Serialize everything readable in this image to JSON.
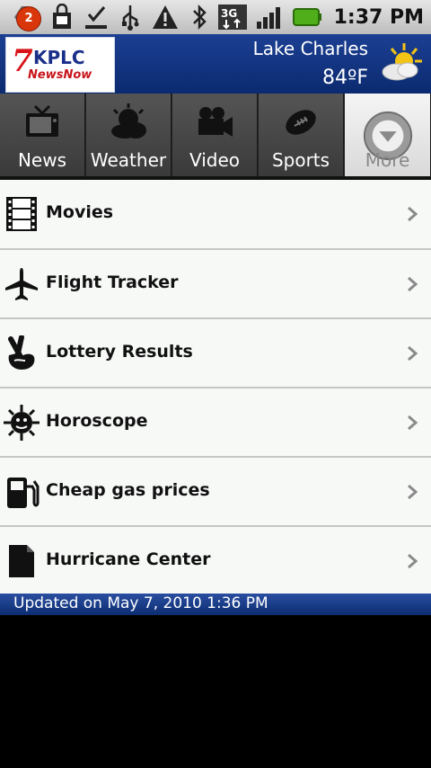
{
  "status_bar": {
    "time": "1:37 PM",
    "notification_count": "2",
    "network": "3G",
    "icons": [
      "notification-badge-icon",
      "shopping-bag-icon",
      "download-done-icon",
      "usb-icon",
      "warning-icon",
      "bluetooth-icon",
      "network-3g-icon",
      "signal-icon",
      "battery-icon"
    ]
  },
  "header": {
    "logo_seven": "7",
    "logo_name": "KPLC",
    "logo_tagline": "NewsNow",
    "city": "Lake Charles",
    "temperature": "84ºF",
    "weather_icon": "partly-cloudy-icon"
  },
  "tabs": [
    {
      "label": "News",
      "icon": "tv-icon"
    },
    {
      "label": "Weather",
      "icon": "cloud-sun-icon"
    },
    {
      "label": "Video",
      "icon": "video-camera-icon"
    },
    {
      "label": "Sports",
      "icon": "football-icon"
    },
    {
      "label": "More",
      "icon": "more-dropdown-icon"
    }
  ],
  "menu_items": [
    {
      "label": "Movies",
      "icon": "film-icon"
    },
    {
      "label": "Flight Tracker",
      "icon": "airplane-icon"
    },
    {
      "label": "Lottery Results",
      "icon": "crossed-fingers-icon"
    },
    {
      "label": "Horoscope",
      "icon": "sun-face-icon"
    },
    {
      "label": "Cheap gas prices",
      "icon": "gas-pump-icon"
    },
    {
      "label": "Hurricane Center",
      "icon": "document-icon"
    }
  ],
  "footer": {
    "updated_text": "Updated on May 7, 2010 1:36 PM"
  },
  "colors": {
    "header_blue": "#0b2a6f",
    "status_gray": "#bdbdbd",
    "list_bg": "#f7f9f7"
  }
}
